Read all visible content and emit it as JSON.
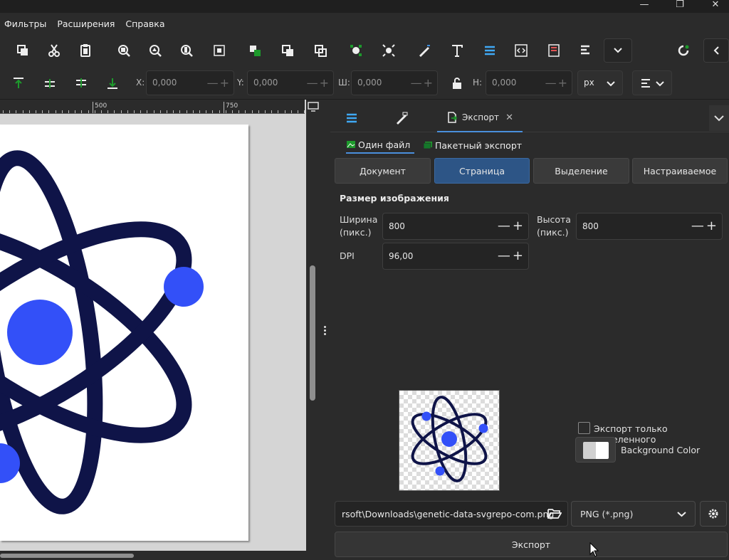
{
  "window": {
    "minimize": "—",
    "maximize": "❐",
    "close": "✕"
  },
  "menu": [
    "Фильтры",
    "Расширения",
    "Справка"
  ],
  "toolbar1": {
    "icons": [
      "copy-icon",
      "cut-icon",
      "paste-icon",
      "zoom-selection-icon",
      "zoom-drawing-icon",
      "zoom-page-icon",
      "zoom-fit-icon",
      "group-icon",
      "ungroup-icon",
      "clone-icon",
      "node-editor-icon",
      "transform-icon",
      "fill-stroke-icon",
      "text-icon",
      "layers-icon",
      "xml-editor-icon",
      "selectors-icon",
      "align-icon"
    ]
  },
  "toolbar2": {
    "x_label": "X:",
    "x_value": "0,000",
    "y_label": "Y:",
    "y_value": "0,000",
    "w_label": "Ш:",
    "w_value": "0,000",
    "h_label": "Н:",
    "h_value": "0,000",
    "unit": "px"
  },
  "ruler": {
    "labels": [
      "500",
      "750"
    ]
  },
  "dock": {
    "export_tab": "Экспорт"
  },
  "export": {
    "subtabs": {
      "single": "Один файл",
      "batch": "Пакетный экспорт"
    },
    "areas": [
      "Документ",
      "Страница",
      "Выделение",
      "Настраиваемое"
    ],
    "active_area": "Страница",
    "size_title": "Размер изображения",
    "width_label_1": "Ширина",
    "width_label_2": "(пикс.)",
    "width_value": "800",
    "height_label_1": "Высота",
    "height_label_2": "(пикс.)",
    "height_value": "800",
    "dpi_label": "DPI",
    "dpi_value": "96,00",
    "only_selected_label": "Экспорт только выделенного",
    "bg_color_label": "Background Color",
    "filename": "rsoft\\Downloads\\genetic-data-svgrepo-com.png",
    "format": "PNG (*.png)",
    "export_button": "Экспорт"
  },
  "colors": {
    "accent": "#4a8fdc",
    "active_area": "#2d5586",
    "atom_dark": "#0f1448",
    "atom_blue": "#3350f8"
  }
}
